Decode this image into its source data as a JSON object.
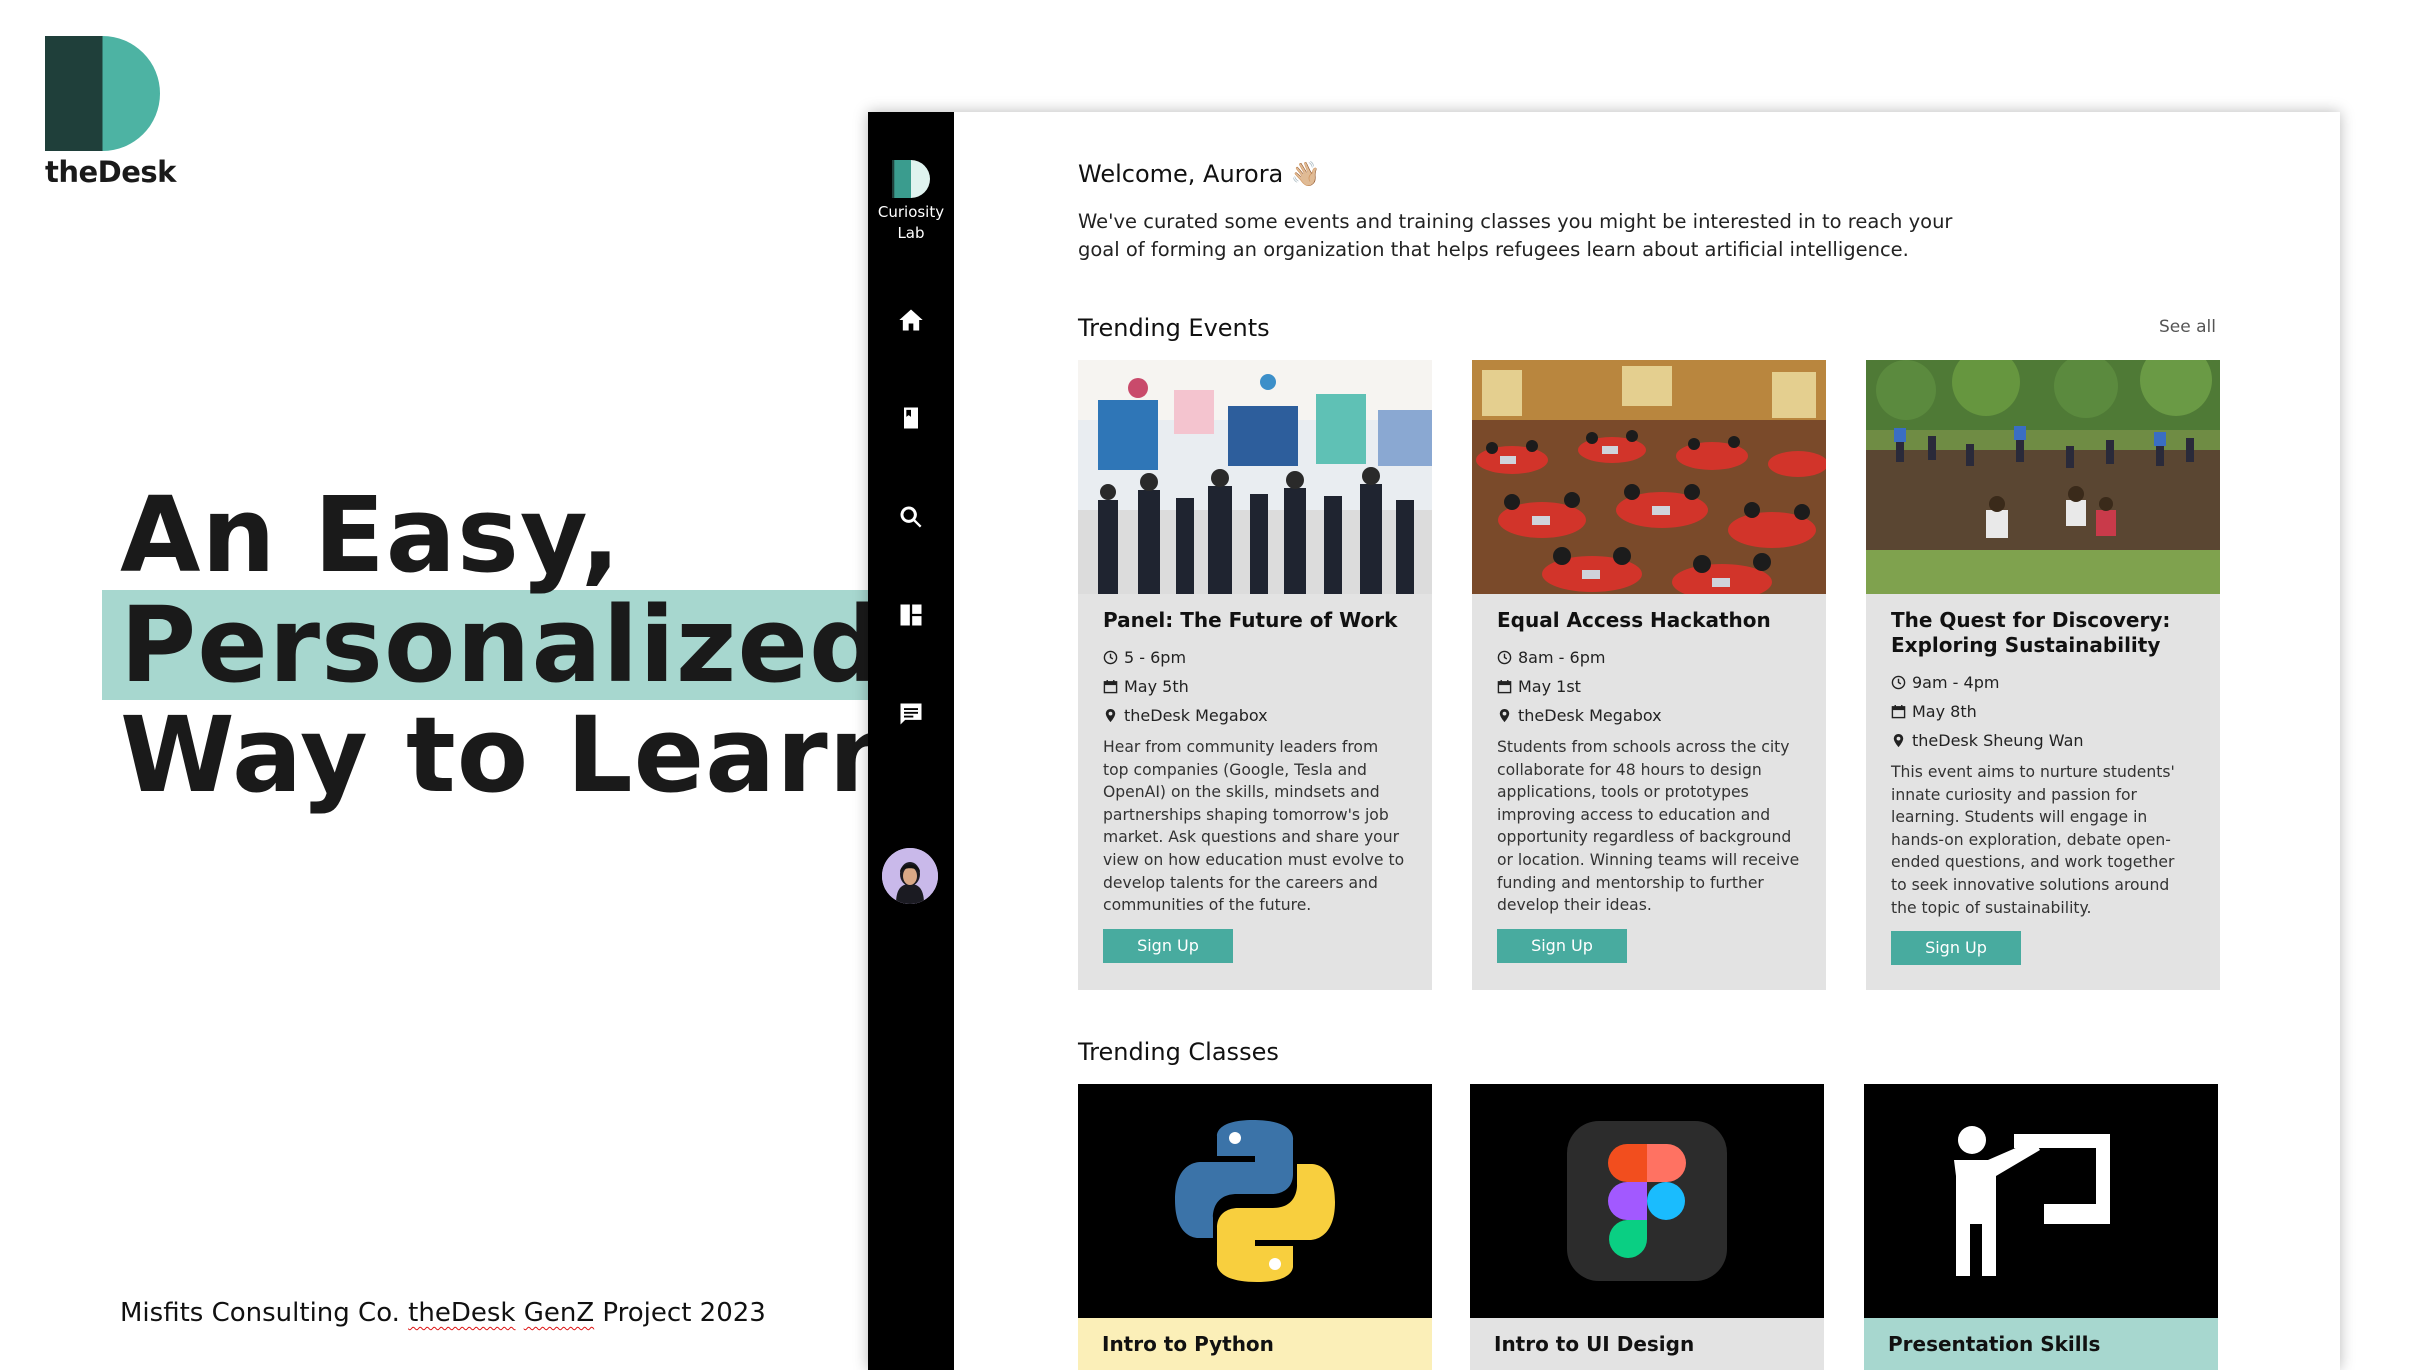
{
  "slide": {
    "logo_text": "theDesk",
    "headline": [
      "An Easy,",
      "Personalized",
      "Way to Learn"
    ],
    "footer": {
      "prefix": "Misfits Consulting Co. ",
      "brand": "theDesk",
      "mid": " ",
      "genz": "GenZ",
      "suffix": " Project 2023"
    }
  },
  "sidebar": {
    "brand_line1": "Curiosity",
    "brand_line2": "Lab",
    "nav": [
      "home-icon",
      "book-icon",
      "search-icon",
      "dashboard-icon",
      "chat-icon"
    ]
  },
  "main": {
    "welcome": "Welcome, Aurora 👋🏼",
    "intro": "We've curated some events and training classes you might be interested in to reach your goal of forming an organization that helps refugees learn about artificial intelligence.",
    "events_title": "Trending Events",
    "see_all": "See all",
    "classes_title": "Trending Classes",
    "events": [
      {
        "title": "Panel: The Future of Work",
        "time": "5 - 6pm",
        "date": "May 5th",
        "location": "theDesk Megabox",
        "description": "Hear from community leaders from top companies (Google, Tesla and OpenAI) on the skills, mindsets and partnerships shaping tomorrow's job market. Ask questions and share your view on how education must evolve to develop talents for the careers and communities of the future.",
        "cta": "Sign Up"
      },
      {
        "title": "Equal Access Hackathon",
        "time": "8am - 6pm",
        "date": "May 1st",
        "location": "theDesk Megabox",
        "description": "Students from schools across the city collaborate for 48 hours to design applications, tools or prototypes improving access to education and opportunity regardless of background or location. Winning teams will receive funding and mentorship to further develop their ideas.",
        "cta": "Sign Up"
      },
      {
        "title": "The Quest for Discovery: Exploring Sustainability",
        "time": "9am - 4pm",
        "date": "May 8th",
        "location": "theDesk Sheung Wan",
        "description": "This event aims to nurture students' innate curiosity and passion for learning. Students will engage in hands-on exploration, debate open-ended questions, and work together to seek innovative solutions around the topic of sustainability.",
        "cta": "Sign Up"
      }
    ],
    "classes": [
      {
        "title": "Intro to Python",
        "bg": "#fbefb8"
      },
      {
        "title": "Intro to UI Design",
        "bg": "#e3e3e3"
      },
      {
        "title": "Presentation Skills",
        "bg": "#a7d7cf"
      }
    ]
  },
  "colors": {
    "accent": "#48ab9f",
    "highlight": "#a7d7cf",
    "card_bg": "#e3e3e3",
    "sidebar_bg": "#000000"
  }
}
